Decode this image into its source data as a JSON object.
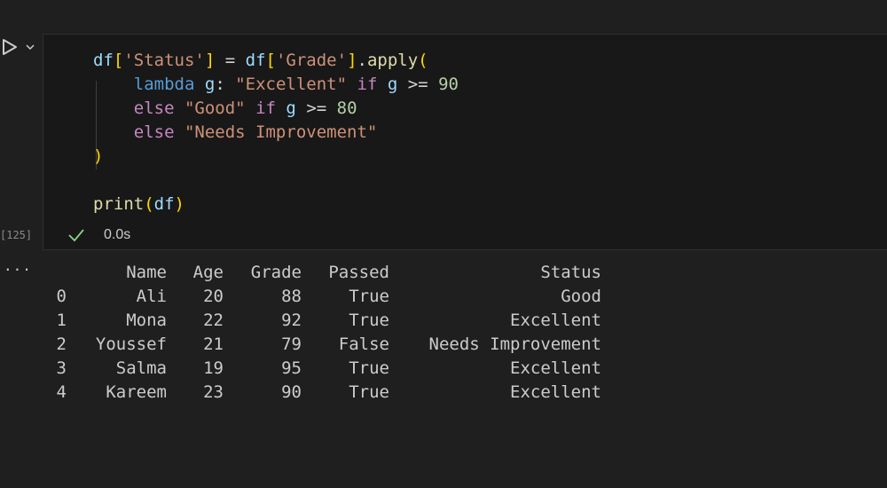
{
  "cell": {
    "run_icon": "play-icon",
    "menu_icon": "chevron-down-icon",
    "execution_count": "[125]",
    "status_icon": "check-icon",
    "exec_time": "0.0s",
    "code_lines": [
      [
        {
          "t": "df",
          "c": "var"
        },
        {
          "t": "[",
          "c": "br1"
        },
        {
          "t": "'Status'",
          "c": "str"
        },
        {
          "t": "]",
          "c": "br1"
        },
        {
          "t": " = ",
          "c": "op"
        },
        {
          "t": "df",
          "c": "var"
        },
        {
          "t": "[",
          "c": "br1"
        },
        {
          "t": "'Grade'",
          "c": "str"
        },
        {
          "t": "]",
          "c": "br1"
        },
        {
          "t": ".",
          "c": "op"
        },
        {
          "t": "apply",
          "c": "fn"
        },
        {
          "t": "(",
          "c": "br1"
        }
      ],
      [
        {
          "t": "    ",
          "c": "op"
        },
        {
          "t": "lambda",
          "c": "decl"
        },
        {
          "t": " ",
          "c": "op"
        },
        {
          "t": "g",
          "c": "var"
        },
        {
          "t": ": ",
          "c": "op"
        },
        {
          "t": "\"Excellent\"",
          "c": "str"
        },
        {
          "t": " ",
          "c": "op"
        },
        {
          "t": "if",
          "c": "kw"
        },
        {
          "t": " ",
          "c": "op"
        },
        {
          "t": "g",
          "c": "var"
        },
        {
          "t": " >= ",
          "c": "op"
        },
        {
          "t": "90",
          "c": "num"
        }
      ],
      [
        {
          "t": "    ",
          "c": "op"
        },
        {
          "t": "else",
          "c": "kw"
        },
        {
          "t": " ",
          "c": "op"
        },
        {
          "t": "\"Good\"",
          "c": "str"
        },
        {
          "t": " ",
          "c": "op"
        },
        {
          "t": "if",
          "c": "kw"
        },
        {
          "t": " ",
          "c": "op"
        },
        {
          "t": "g",
          "c": "var"
        },
        {
          "t": " >= ",
          "c": "op"
        },
        {
          "t": "80",
          "c": "num"
        }
      ],
      [
        {
          "t": "    ",
          "c": "op"
        },
        {
          "t": "else",
          "c": "kw"
        },
        {
          "t": " ",
          "c": "op"
        },
        {
          "t": "\"Needs Improvement\"",
          "c": "str"
        }
      ],
      [
        {
          "t": ")",
          "c": "br1"
        }
      ],
      [],
      [
        {
          "t": "print",
          "c": "fn"
        },
        {
          "t": "(",
          "c": "br1"
        },
        {
          "t": "df",
          "c": "var"
        },
        {
          "t": ")",
          "c": "br1"
        }
      ]
    ]
  },
  "output": {
    "more_label": "...",
    "columns": [
      "",
      "Name",
      "Age",
      "Grade",
      "Passed",
      "Status"
    ],
    "rows": [
      [
        "0",
        "Ali",
        "20",
        "88",
        "True",
        "Good"
      ],
      [
        "1",
        "Mona",
        "22",
        "92",
        "True",
        "Excellent"
      ],
      [
        "2",
        "Youssef",
        "21",
        "79",
        "False",
        "Needs Improvement"
      ],
      [
        "3",
        "Salma",
        "19",
        "95",
        "True",
        "Excellent"
      ],
      [
        "4",
        "Kareem",
        "23",
        "90",
        "True",
        "Excellent"
      ]
    ]
  },
  "colors": {
    "background": "#1f1f1f",
    "cell_background": "#181818",
    "success": "#89d185"
  }
}
